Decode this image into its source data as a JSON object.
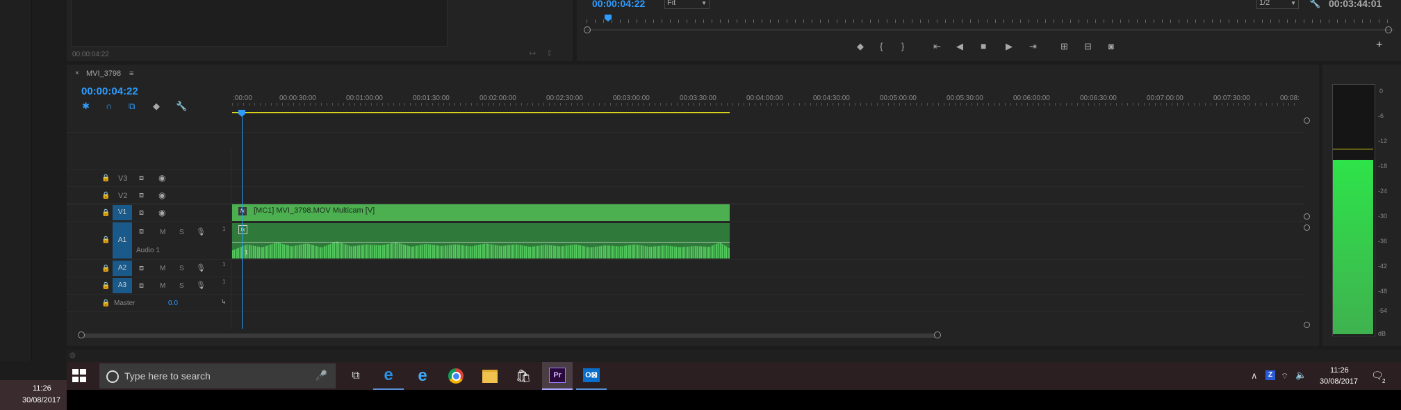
{
  "program_monitor": {
    "timecode": "00:00:04:22",
    "zoom": "Fit",
    "resolution": "1/2",
    "duration": "00:03:44:01"
  },
  "source_monitor": {
    "timecode": "00:00:04:22"
  },
  "sequence": {
    "name": "MVI_3798",
    "timecode": "00:00:04:22",
    "ruler": [
      ":00:00",
      "00:00:30:00",
      "00:01:00:00",
      "00:01:30:00",
      "00:02:00:00",
      "00:02:30:00",
      "00:03:00:00",
      "00:03:30:00",
      "00:04:00:00",
      "00:04:30:00",
      "00:05:00:00",
      "00:05:30:00",
      "00:06:00:00",
      "00:06:30:00",
      "00:07:00:00",
      "00:07:30:00",
      "00:08:"
    ]
  },
  "tracks": {
    "v3": "V3",
    "v2": "V2",
    "v1": "V1",
    "a1": "A1",
    "a1_name": "Audio 1",
    "a2": "A2",
    "a3": "A3",
    "mute": "M",
    "solo": "S",
    "master": "Master",
    "master_value": "0.0"
  },
  "clips": {
    "video": "[MC1] MVI_3798.MOV Multicam [V]",
    "fx": "fx",
    "audio_channel": "1"
  },
  "meter": {
    "scale": [
      "0",
      "-6",
      "-12",
      "-18",
      "-24",
      "-30",
      "-36",
      "-42",
      "-48",
      "-54",
      "dB"
    ]
  },
  "taskbar": {
    "search_placeholder": "Type here to search",
    "time": "11:26",
    "date": "30/08/2017",
    "notification_count": "2"
  },
  "desktop_clock": {
    "time": "11:26",
    "date": "30/08/2017"
  },
  "colors": {
    "accent_blue": "#2d9cff",
    "clip_green": "#4caf50",
    "track_blue": "#1a5a8a"
  }
}
